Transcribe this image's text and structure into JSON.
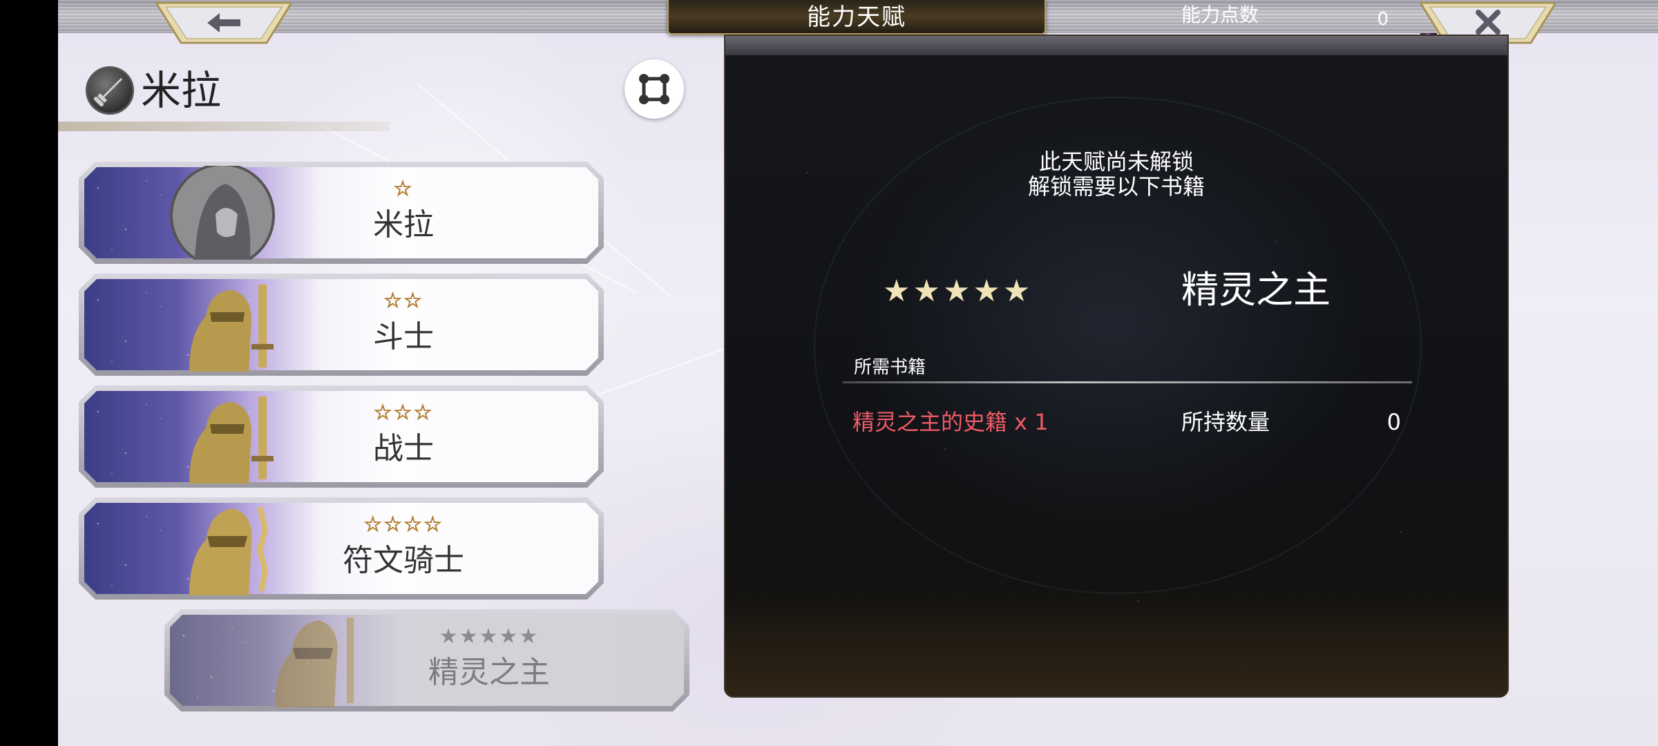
{
  "header": {
    "title": "能力天赋",
    "points_label": "能力点数",
    "points_value": "0",
    "back_icon": "arrow-left-icon",
    "close_icon": "close-icon"
  },
  "character": {
    "name": "米拉",
    "icon": "sword-emblem-icon"
  },
  "filter_button": {
    "icon": "expand-nodes-icon"
  },
  "classes": [
    {
      "label": "米拉",
      "stars": "☆",
      "rank": 1,
      "locked": false
    },
    {
      "label": "斗士",
      "stars": "☆☆",
      "rank": 2,
      "locked": false
    },
    {
      "label": "战士",
      "stars": "☆☆☆",
      "rank": 3,
      "locked": false
    },
    {
      "label": "符文骑士",
      "stars": "☆☆☆☆",
      "rank": 4,
      "locked": false
    },
    {
      "label": "精灵之主",
      "stars": "★★★★★",
      "rank": 5,
      "locked": true
    }
  ],
  "detail": {
    "lock_line1": "此天赋尚未解锁",
    "lock_line2": "解锁需要以下书籍",
    "req_stars": "★★★★★",
    "req_name": "精灵之主",
    "books_header": "所需书籍",
    "book_name": "精灵之主的史籍 x 1",
    "held_label": "所持数量",
    "held_value": "0"
  },
  "colors": {
    "book_required": "#ef5b67",
    "panel_bg": "#121418",
    "star_gold": "#f4dca0"
  }
}
